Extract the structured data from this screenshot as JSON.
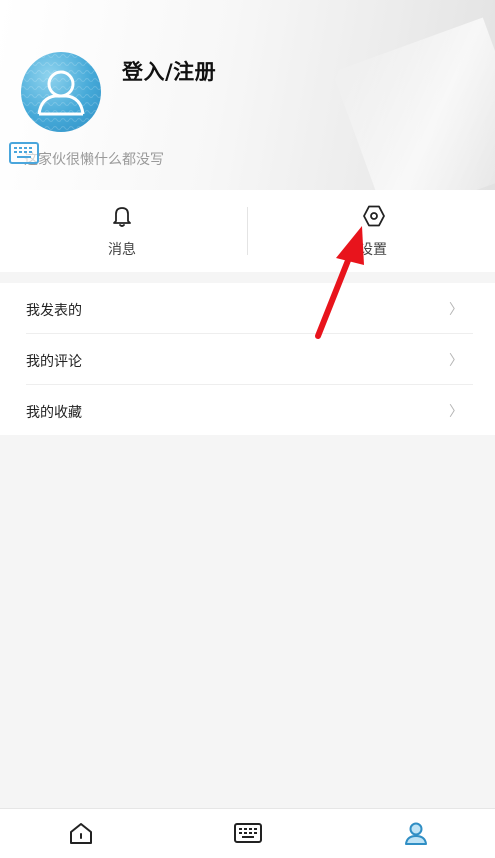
{
  "profile": {
    "title": "登入/注册",
    "bio": "这家伙很懒什么都没写"
  },
  "quick_actions": {
    "messages_label": "消息",
    "settings_label": "设置"
  },
  "menu": {
    "items": [
      {
        "label": "我发表的",
        "chevron": "〉"
      },
      {
        "label": "我的评论",
        "chevron": "〉"
      },
      {
        "label": "我的收藏",
        "chevron": "〉"
      }
    ]
  },
  "icons": {
    "avatar": "user-silhouette-icon",
    "messages": "bell-icon",
    "settings": "hexagon-gear-icon",
    "nav_home": "home-icon",
    "nav_keyboard": "keyboard-icon",
    "nav_profile": "user-icon",
    "overlay": "keyboard-icon"
  },
  "colors": {
    "accent": "#3aa0d8",
    "annotation_arrow": "#e8141c",
    "text_primary": "#222222",
    "text_secondary": "#9a9a9a"
  }
}
